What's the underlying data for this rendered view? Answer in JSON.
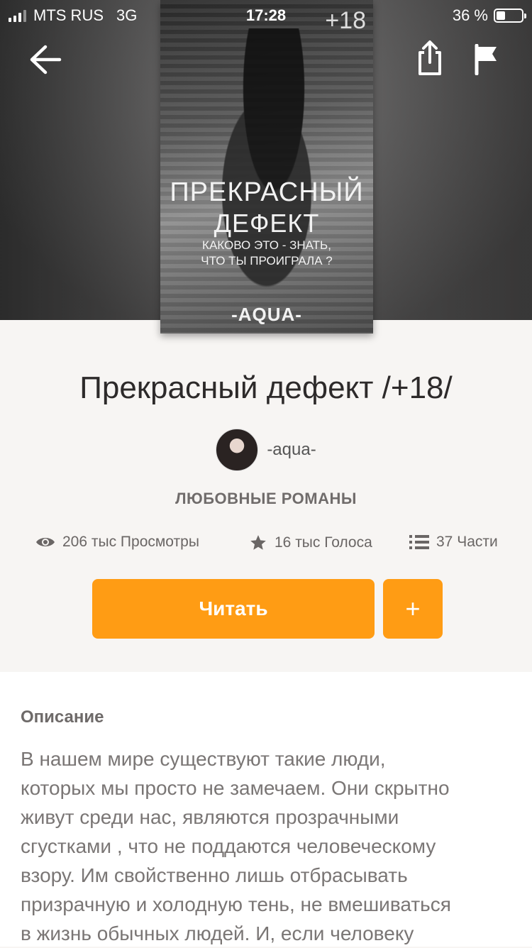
{
  "status_bar": {
    "carrier": "MTS RUS",
    "network": "3G",
    "time": "17:28",
    "battery_pct": "36 %",
    "battery_level": 0.36
  },
  "nav": {
    "back_icon": "arrow-left-icon",
    "share_icon": "share-icon",
    "report_icon": "flag-icon"
  },
  "cover": {
    "badge": "+18",
    "title_line1": "ПРЕКРАСНЫЙ",
    "title_line2": "ДЕФЕКТ",
    "tagline_line1": "КАКОВО ЭТО - ЗНАТЬ,",
    "tagline_line2": "ЧТО ТЫ ПРОИГРАЛА ?",
    "author_mark": "-AQUA-"
  },
  "book": {
    "title": "Прекрасный дефект /+18/",
    "author": "-aqua-",
    "genre": "ЛЮБОВНЫЕ РОМАНЫ"
  },
  "stats": {
    "views": "206 тыс Просмотры",
    "votes": "16 тыс Голоса",
    "parts": "37 Части"
  },
  "actions": {
    "read_label": "Читать",
    "add_label": "+"
  },
  "description": {
    "heading": "Описание",
    "lines": [
      "В нашем мире существуют такие люди,",
      "которых мы просто не замечаем. Они скрытно",
      "живут среди нас, являются прозрачными",
      "сгустками , что не поддаются человеческому",
      "взору. Им свойственно лишь отбрасывать",
      "призрачную и холодную тень, не вмешиваться",
      "в жизнь обычных людей. И, если человеку"
    ]
  }
}
